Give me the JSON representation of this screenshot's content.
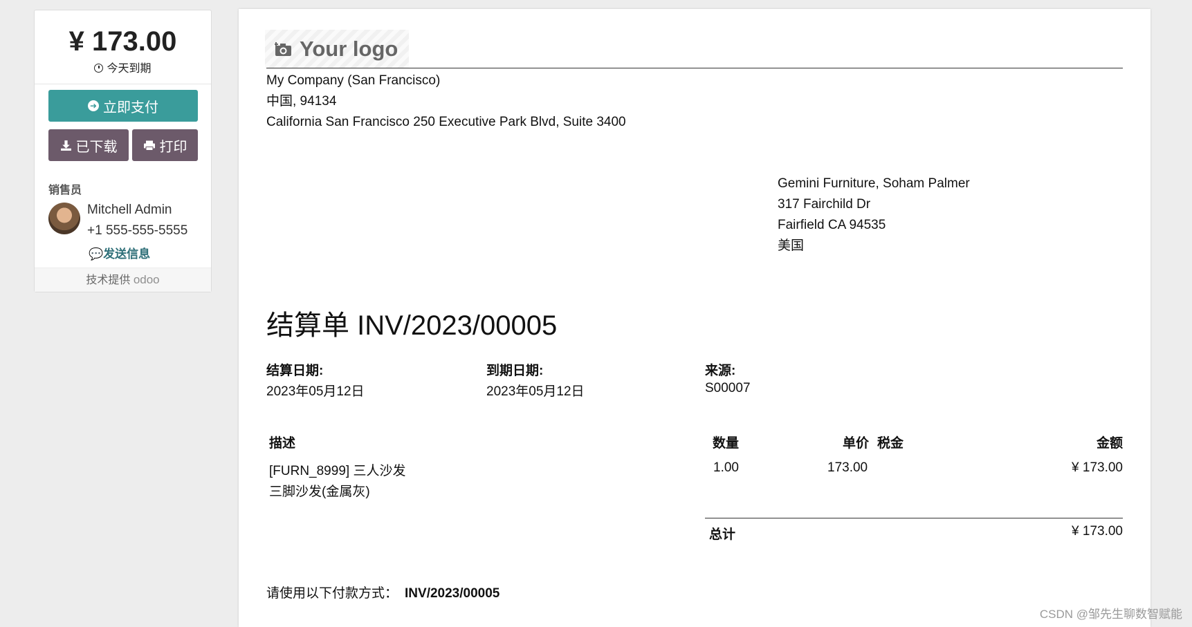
{
  "sidebar": {
    "amount": "¥ 173.00",
    "due_text": "今天到期",
    "pay_button": "立即支付",
    "download_button": "已下载",
    "print_button": "打印",
    "salesperson_label": "销售员",
    "salesperson_name": "Mitchell Admin",
    "salesperson_phone": "+1 555-555-5555",
    "send_message": "发送信息",
    "powered_by": "技术提供",
    "odoo_brand": "odoo"
  },
  "document": {
    "logo_text": "Your logo",
    "company": {
      "name": "My Company (San Francisco)",
      "line2": "中国, 94134",
      "line3": "California San Francisco 250 Executive Park Blvd, Suite 3400"
    },
    "partner": {
      "name": "Gemini Furniture, Soham Palmer",
      "street": "317 Fairchild Dr",
      "city": "Fairfield CA 94535",
      "country": "美国"
    },
    "title": "结算单 INV/2023/00005",
    "info": [
      {
        "label": "结算日期:",
        "value": "2023年05月12日"
      },
      {
        "label": "到期日期:",
        "value": "2023年05月12日"
      },
      {
        "label": "来源:",
        "value": "S00007"
      }
    ],
    "table": {
      "headers": {
        "description": "描述",
        "quantity": "数量",
        "unit_price": "单价",
        "taxes": "税金",
        "amount": "金额"
      },
      "rows": [
        {
          "description_line1": "[FURN_8999] 三人沙发",
          "description_line2": "三脚沙发(金属灰)",
          "quantity": "1.00",
          "unit_price": "173.00",
          "amount": "¥ 173.00"
        }
      ],
      "total_label": "总计",
      "total_value": "¥ 173.00"
    },
    "payment_note_label": "请使用以下付款方式：",
    "payment_reference": "INV/2023/00005"
  },
  "watermark": "CSDN @邹先生聊数智赋能",
  "colors": {
    "pay_button": "#3a9c9b",
    "secondary_button": "#6c5a6a",
    "link": "#2e6f78"
  }
}
